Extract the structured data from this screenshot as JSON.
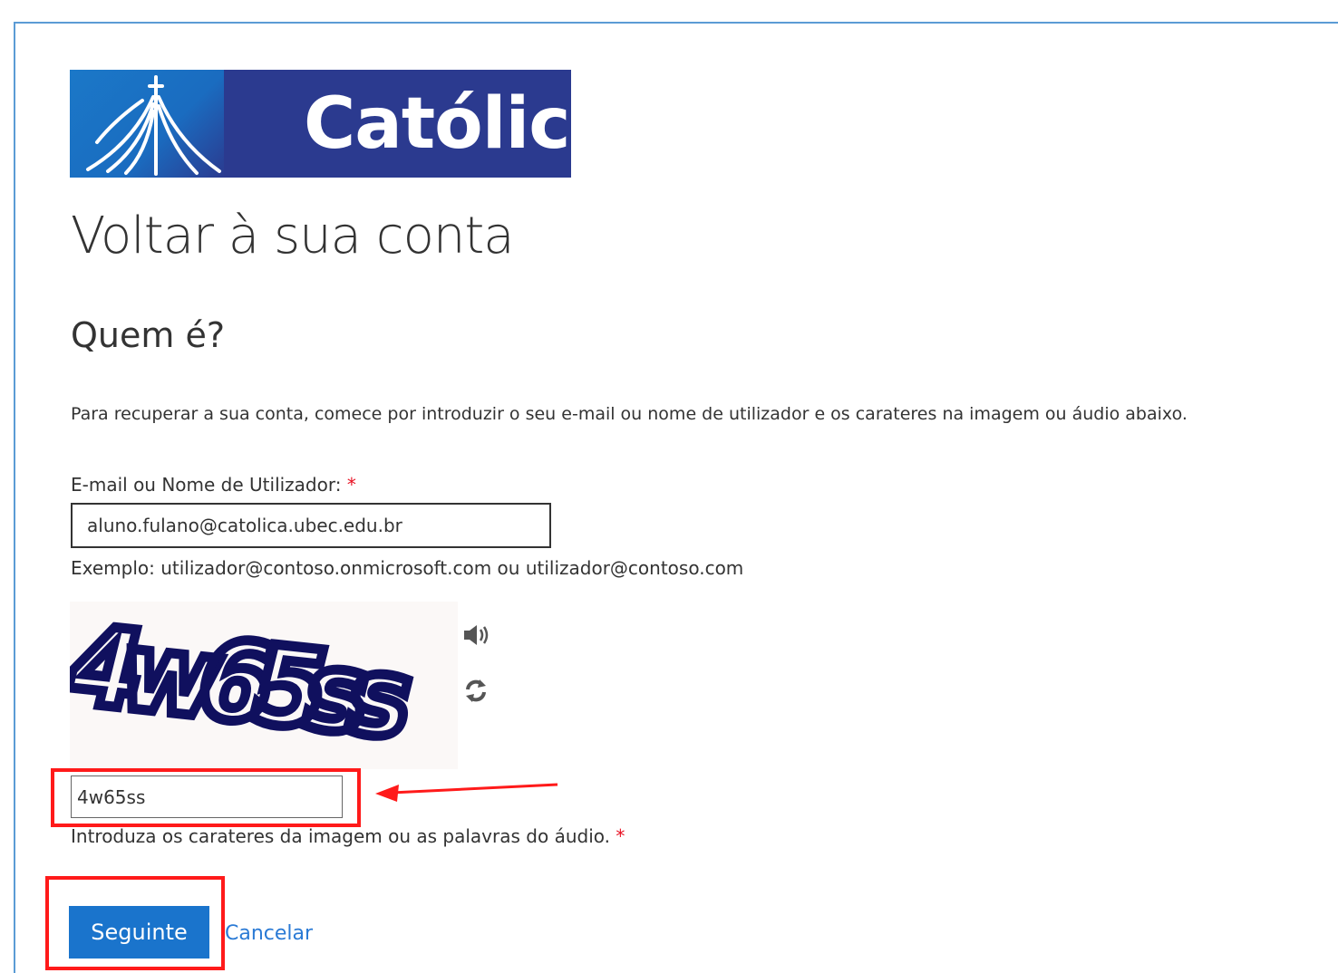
{
  "logo": {
    "text": "Católica"
  },
  "page": {
    "title": "Voltar à sua conta",
    "subtitle": "Quem é?",
    "description": "Para recuperar a sua conta, comece por introduzir o seu e-mail ou nome de utilizador e os carateres na imagem ou áudio abaixo."
  },
  "form": {
    "email_label": "E-mail ou Nome de Utilizador: ",
    "required_mark": "*",
    "email_value": "aluno.fulano@catolica.ubec.edu.br",
    "email_example": "Exemplo: utilizador@contoso.onmicrosoft.com ou utilizador@contoso.com",
    "captcha_image_text": "4w65ss",
    "captcha_value": "4w65ss",
    "captcha_label": "Introduza os carateres da imagem ou as palavras do áudio. ",
    "next_label": "Seguinte",
    "cancel_label": "Cancelar"
  },
  "icons": {
    "audio": "speaker-icon",
    "refresh": "refresh-icon"
  },
  "colors": {
    "primary_button": "#1a74cc",
    "link": "#2a7ad5",
    "highlight": "#ff1a1a",
    "logo_bg": "#2b3a8f",
    "captcha_ink": "#10105e"
  }
}
